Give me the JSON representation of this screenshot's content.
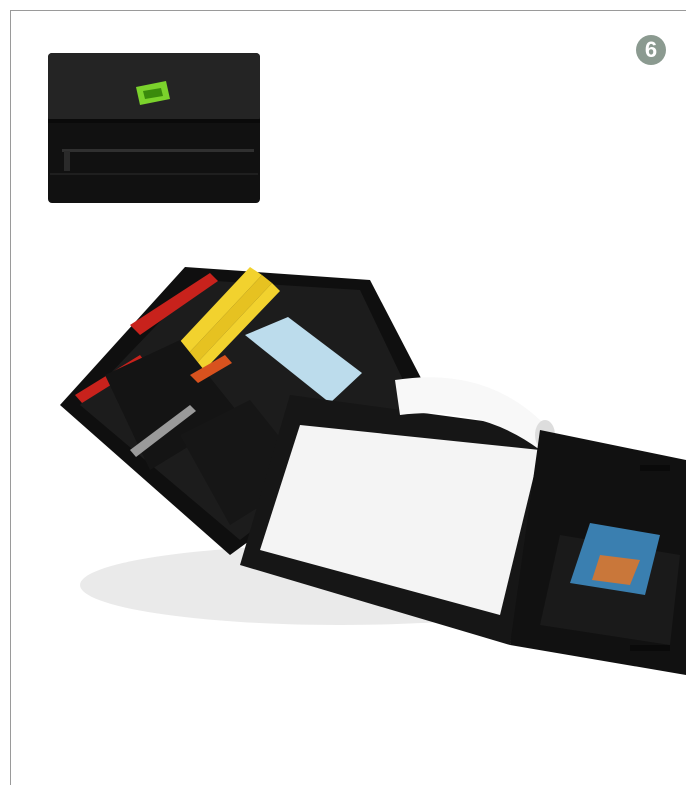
{
  "page": {
    "badge_number": "6"
  },
  "images": {
    "closed_folder": {
      "icon": "closed-black-portfolio-with-green-logo"
    },
    "open_folder": {
      "icon": "open-black-portfolio-with-notepad-ruler-pens-cards"
    }
  },
  "colors": {
    "frame": "#9a9a9a",
    "badge": "#8b9a90",
    "logo_green": "#7bd22c",
    "fabric": "#141414",
    "paper": "#f4f4f4",
    "ruler": "#f2d22e",
    "pen_red": "#c8221c"
  }
}
